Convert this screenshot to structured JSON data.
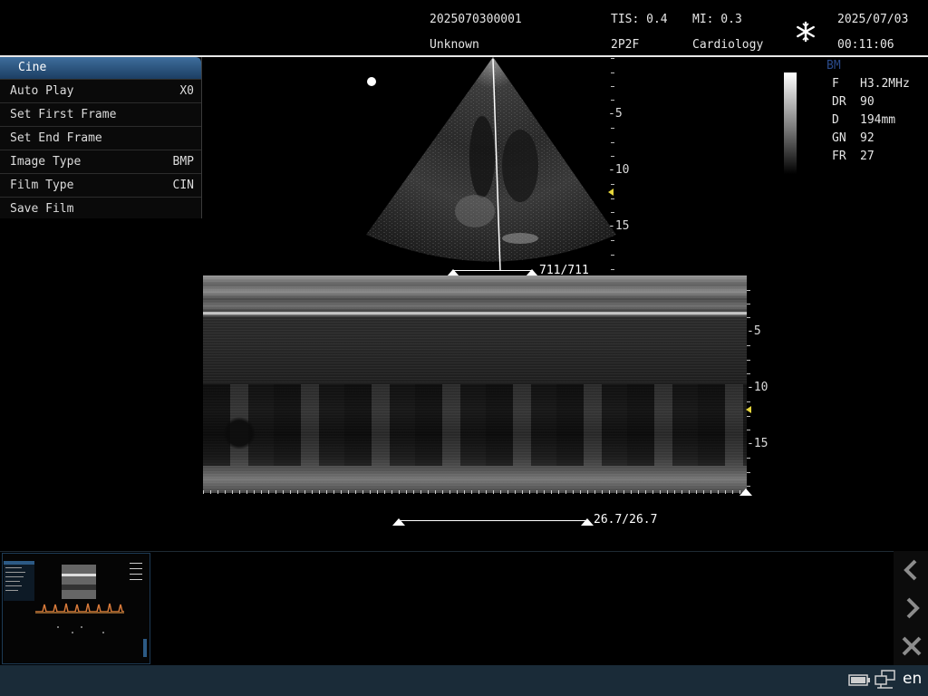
{
  "header": {
    "patient_id": "2025070300001",
    "patient_name": "Unknown",
    "tis": "TIS: 0.4",
    "probe": "2P2F",
    "mi": "MI: 0.3",
    "exam": "Cardiology",
    "date": "2025/07/03",
    "time": "00:11:06",
    "freeze_icon": "snowflake-icon"
  },
  "menu": {
    "title": "Cine",
    "items": [
      {
        "label": "Auto Play",
        "value": "X0"
      },
      {
        "label": "Set First Frame",
        "value": ""
      },
      {
        "label": "Set End Frame",
        "value": ""
      },
      {
        "label": "Image Type",
        "value": "BMP"
      },
      {
        "label": "Film Type",
        "value": "CIN"
      },
      {
        "label": "Save Film",
        "value": ""
      }
    ]
  },
  "bmode": {
    "depth_labels": [
      "-5",
      "-10",
      "-15"
    ],
    "frame_counter": "711/711"
  },
  "mmode": {
    "depth_labels": [
      "-5",
      "-10",
      "-15"
    ],
    "time_counter": "26.7/26.7"
  },
  "params": {
    "mode": "BM",
    "rows": [
      {
        "key": "F",
        "value": "H3.2MHz"
      },
      {
        "key": "DR",
        "value": "90"
      },
      {
        "key": "D",
        "value": "194mm"
      },
      {
        "key": "GN",
        "value": "92"
      },
      {
        "key": "FR",
        "value": "27"
      }
    ]
  },
  "nav": {
    "prev_icon": "chevron-left-icon",
    "next_icon": "chevron-right-icon",
    "close_icon": "close-icon"
  },
  "status": {
    "language": "en",
    "battery_icon": "battery-icon",
    "network_icon": "network-icon"
  },
  "colors": {
    "menu_header": "#2c5a85",
    "status_bar": "#1a2b38",
    "depth_marker": "#e6d63b"
  }
}
